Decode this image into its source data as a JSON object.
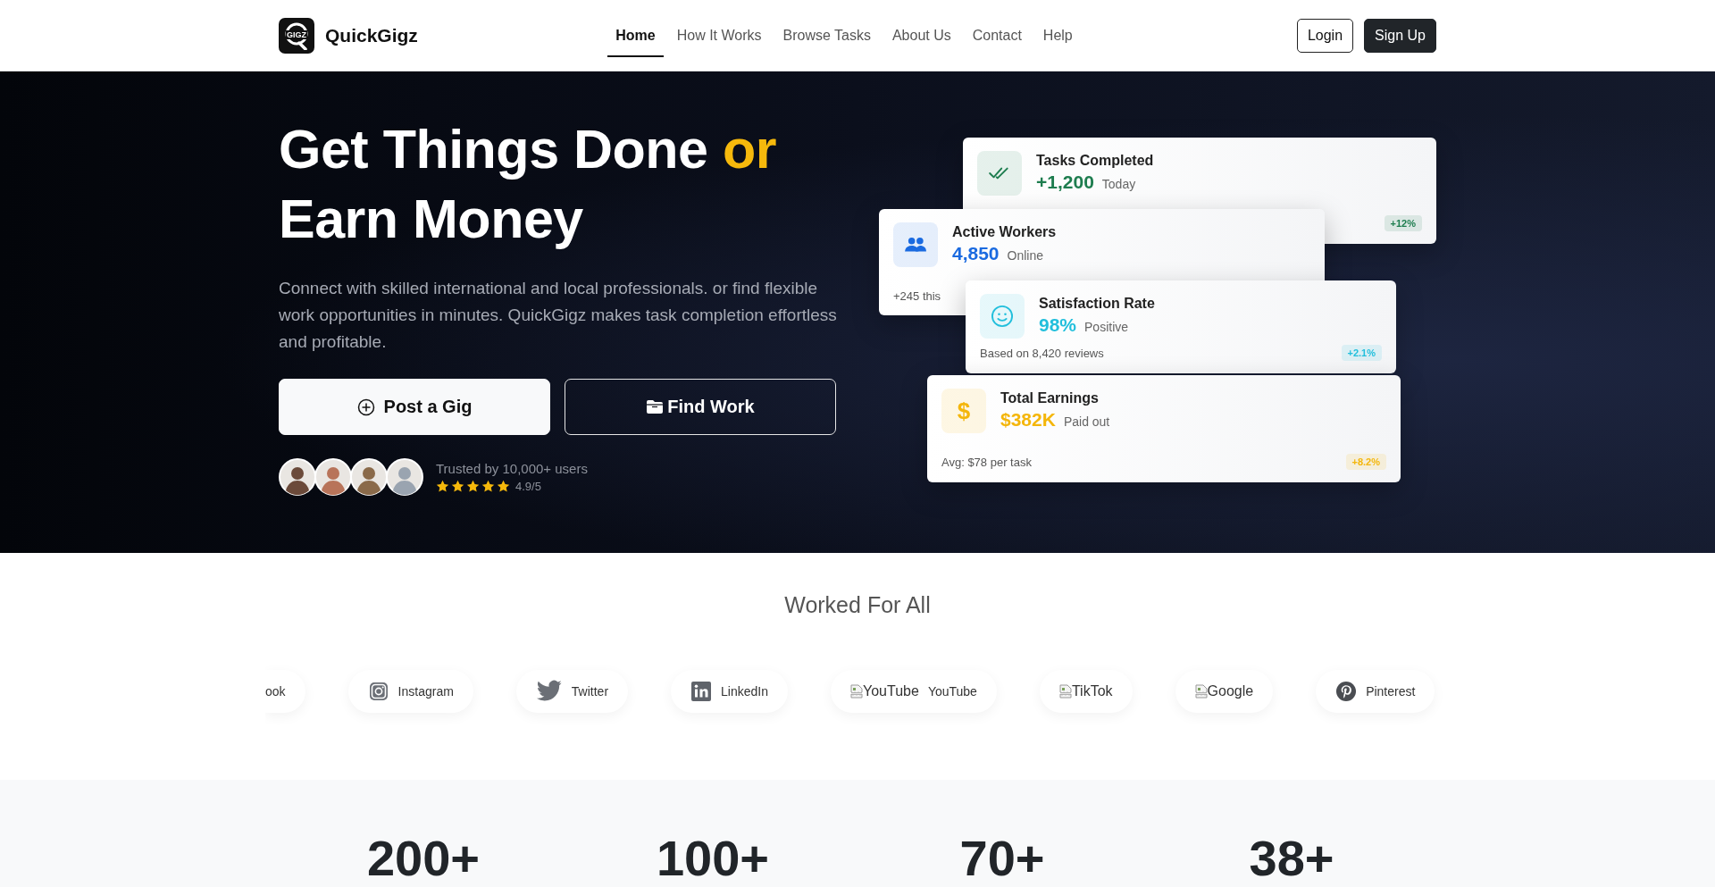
{
  "header": {
    "brand": {
      "logo_text": "GIGZ",
      "name": "QuickGigz"
    },
    "nav": [
      {
        "label": "Home",
        "selected": true
      },
      {
        "label": "How It Works",
        "selected": false
      },
      {
        "label": "Browse Tasks",
        "selected": false
      },
      {
        "label": "About Us",
        "selected": false
      },
      {
        "label": "Contact",
        "selected": false
      },
      {
        "label": "Help",
        "selected": false
      }
    ],
    "buttons": [
      {
        "kind": "outline",
        "label": "Login"
      },
      {
        "kind": "solid",
        "label": "Sign Up"
      }
    ]
  },
  "hero": {
    "title": "Get Things Done",
    "title_highlight": "or",
    "title_line2": "Earn Money",
    "description": "Connect with skilled international and local professionals. or find flexible work opportunities in minutes. QuickGigz makes task completion effortless and profitable.",
    "buttons": [
      {
        "kind": "primary",
        "label": "Post a Gig"
      },
      {
        "kind": "outline",
        "label": "Find Work"
      }
    ],
    "trust": {
      "avatars": [
        {
          "kind": "person"
        },
        {
          "kind": "person"
        },
        {
          "kind": "person"
        },
        {
          "kind": "person"
        }
      ],
      "text": "Trusted by 10,000+ users",
      "stars": 5,
      "rating": "4.9/5"
    },
    "cards": [
      {
        "kind": "check",
        "title": "Tasks Completed",
        "value": "+1,200",
        "sub": "Today",
        "badge": "+12%",
        "color": "#1e7d4f"
      },
      {
        "kind": "people",
        "title": "Active Workers",
        "value": "4,850",
        "sub": "Online",
        "footer": "+245 this",
        "color": "#1a6ae0"
      },
      {
        "kind": "smile",
        "title": "Satisfaction Rate",
        "value": "98%",
        "sub": "Positive",
        "footer": "Based on 8,420 reviews",
        "badge": "+2.1%",
        "color": "#22bfdc"
      },
      {
        "kind": "symbol",
        "icon_text": "$",
        "title": "Total Earnings",
        "value": "$382K",
        "sub": "Paid out",
        "footer": "Avg: $78 per task",
        "badge": "+8.2%",
        "color": "#f4b60b"
      }
    ]
  },
  "partners": {
    "heading": "Worked For All",
    "logos": [
      {
        "kind": "cut",
        "label": "ook"
      },
      {
        "kind": "instagram",
        "label": "Instagram"
      },
      {
        "kind": "twitter",
        "label": "Twitter"
      },
      {
        "kind": "linkedin",
        "label": "LinkedIn"
      },
      {
        "kind": "broken_image",
        "alt": "YouTube",
        "label": "YouTube"
      },
      {
        "kind": "broken_image",
        "alt": "TikTok"
      },
      {
        "kind": "broken_image",
        "alt": "Google"
      },
      {
        "kind": "pinterest",
        "label": "Pinterest"
      }
    ]
  },
  "stats": [
    "200+",
    "100+",
    "70+",
    "38+"
  ]
}
